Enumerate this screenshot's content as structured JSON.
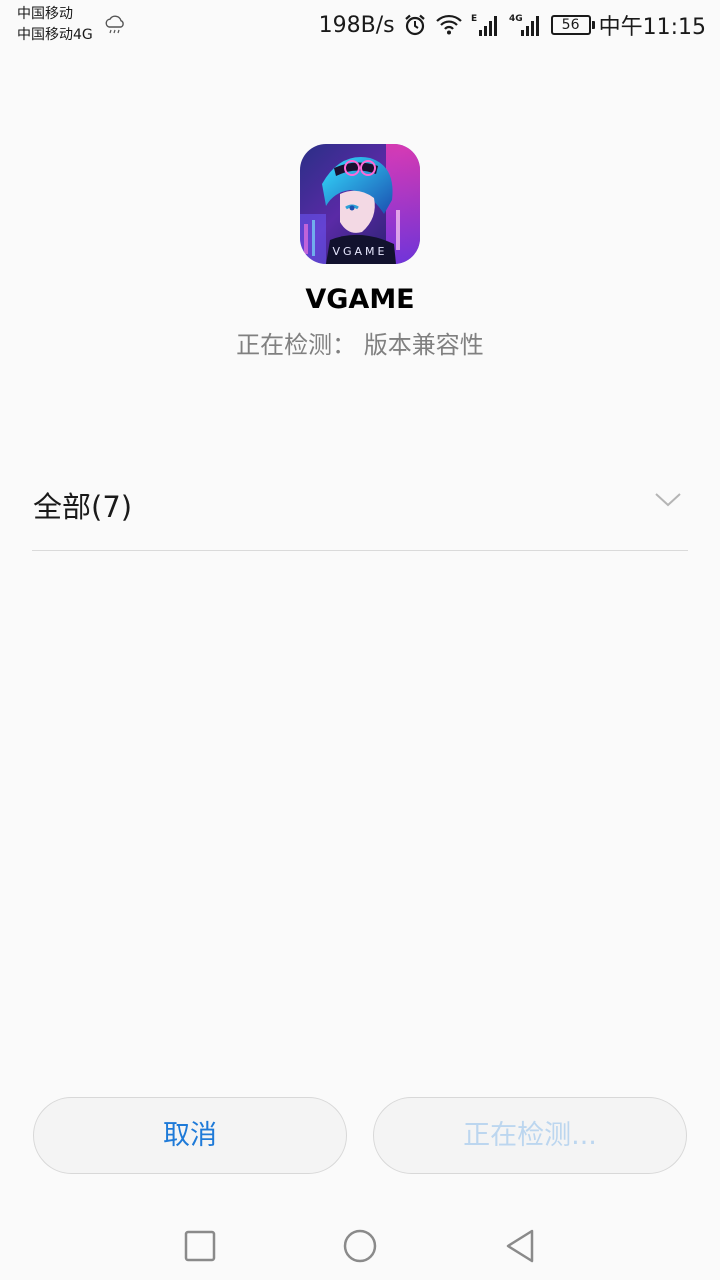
{
  "status_bar": {
    "carrier_1": "中国移动",
    "carrier_2": "中国移动4G",
    "weather_icon": "cloud-rain-icon",
    "net_speed": "198B/s",
    "alarm_icon": "alarm-clock-icon",
    "wifi_icon": "wifi-icon",
    "signal_1_label": "E",
    "signal_2_label": "4G",
    "battery_level": "56",
    "time": "中午11:15"
  },
  "app": {
    "icon": "vgame-app-icon",
    "icon_text": "VGAME",
    "name": "VGAME",
    "status": "正在检测： 版本兼容性"
  },
  "list": {
    "all_label": "全部(7)",
    "expand_icon": "chevron-down-icon"
  },
  "buttons": {
    "cancel": "取消",
    "detecting": "正在检测..."
  },
  "nav": {
    "recent_icon": "square-recent-apps-icon",
    "home_icon": "circle-home-icon",
    "back_icon": "triangle-back-icon"
  },
  "colors": {
    "background": "#fafafa",
    "accent": "#1e7ad8",
    "disabled_text": "#bcd6ef",
    "secondary_text": "#808080"
  }
}
